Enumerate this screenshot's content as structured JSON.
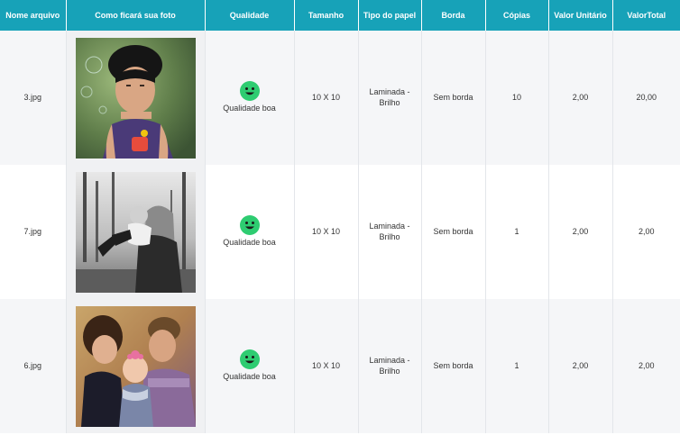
{
  "table": {
    "headers": [
      "Nome arquivo",
      "Como ficará sua foto",
      "Qualidade",
      "Tamanho",
      "Tipo do papel",
      "Borda",
      "Cópias",
      "Valor Unitário",
      "ValorTotal"
    ],
    "rows": [
      {
        "file": "3.jpg",
        "thumbnail_icon": "photo-girl-bubbles",
        "quality_icon": "smiley-face-icon",
        "quality": "Qualidade boa",
        "size": "10 X 10",
        "paper_line1": "Laminada -",
        "paper_line2": "Brilho",
        "border": "Sem borda",
        "copies": "10",
        "unit_value": "2,00",
        "total_value": "20,00"
      },
      {
        "file": "7.jpg",
        "thumbnail_icon": "photo-mother-child-bw",
        "quality_icon": "smiley-face-icon",
        "quality": "Qualidade boa",
        "size": "10 X 10",
        "paper_line1": "Laminada -",
        "paper_line2": "Brilho",
        "border": "Sem borda",
        "copies": "1",
        "unit_value": "2,00",
        "total_value": "2,00"
      },
      {
        "file": "6.jpg",
        "thumbnail_icon": "photo-family-kiss",
        "quality_icon": "smiley-face-icon",
        "quality": "Qualidade boa",
        "size": "10 X 10",
        "paper_line1": "Laminada -",
        "paper_line2": "Brilho",
        "border": "Sem borda",
        "copies": "1",
        "unit_value": "2,00",
        "total_value": "2,00"
      }
    ]
  },
  "colors": {
    "header_bg": "#17a2b8",
    "smiley_green": "#2ecc71"
  }
}
